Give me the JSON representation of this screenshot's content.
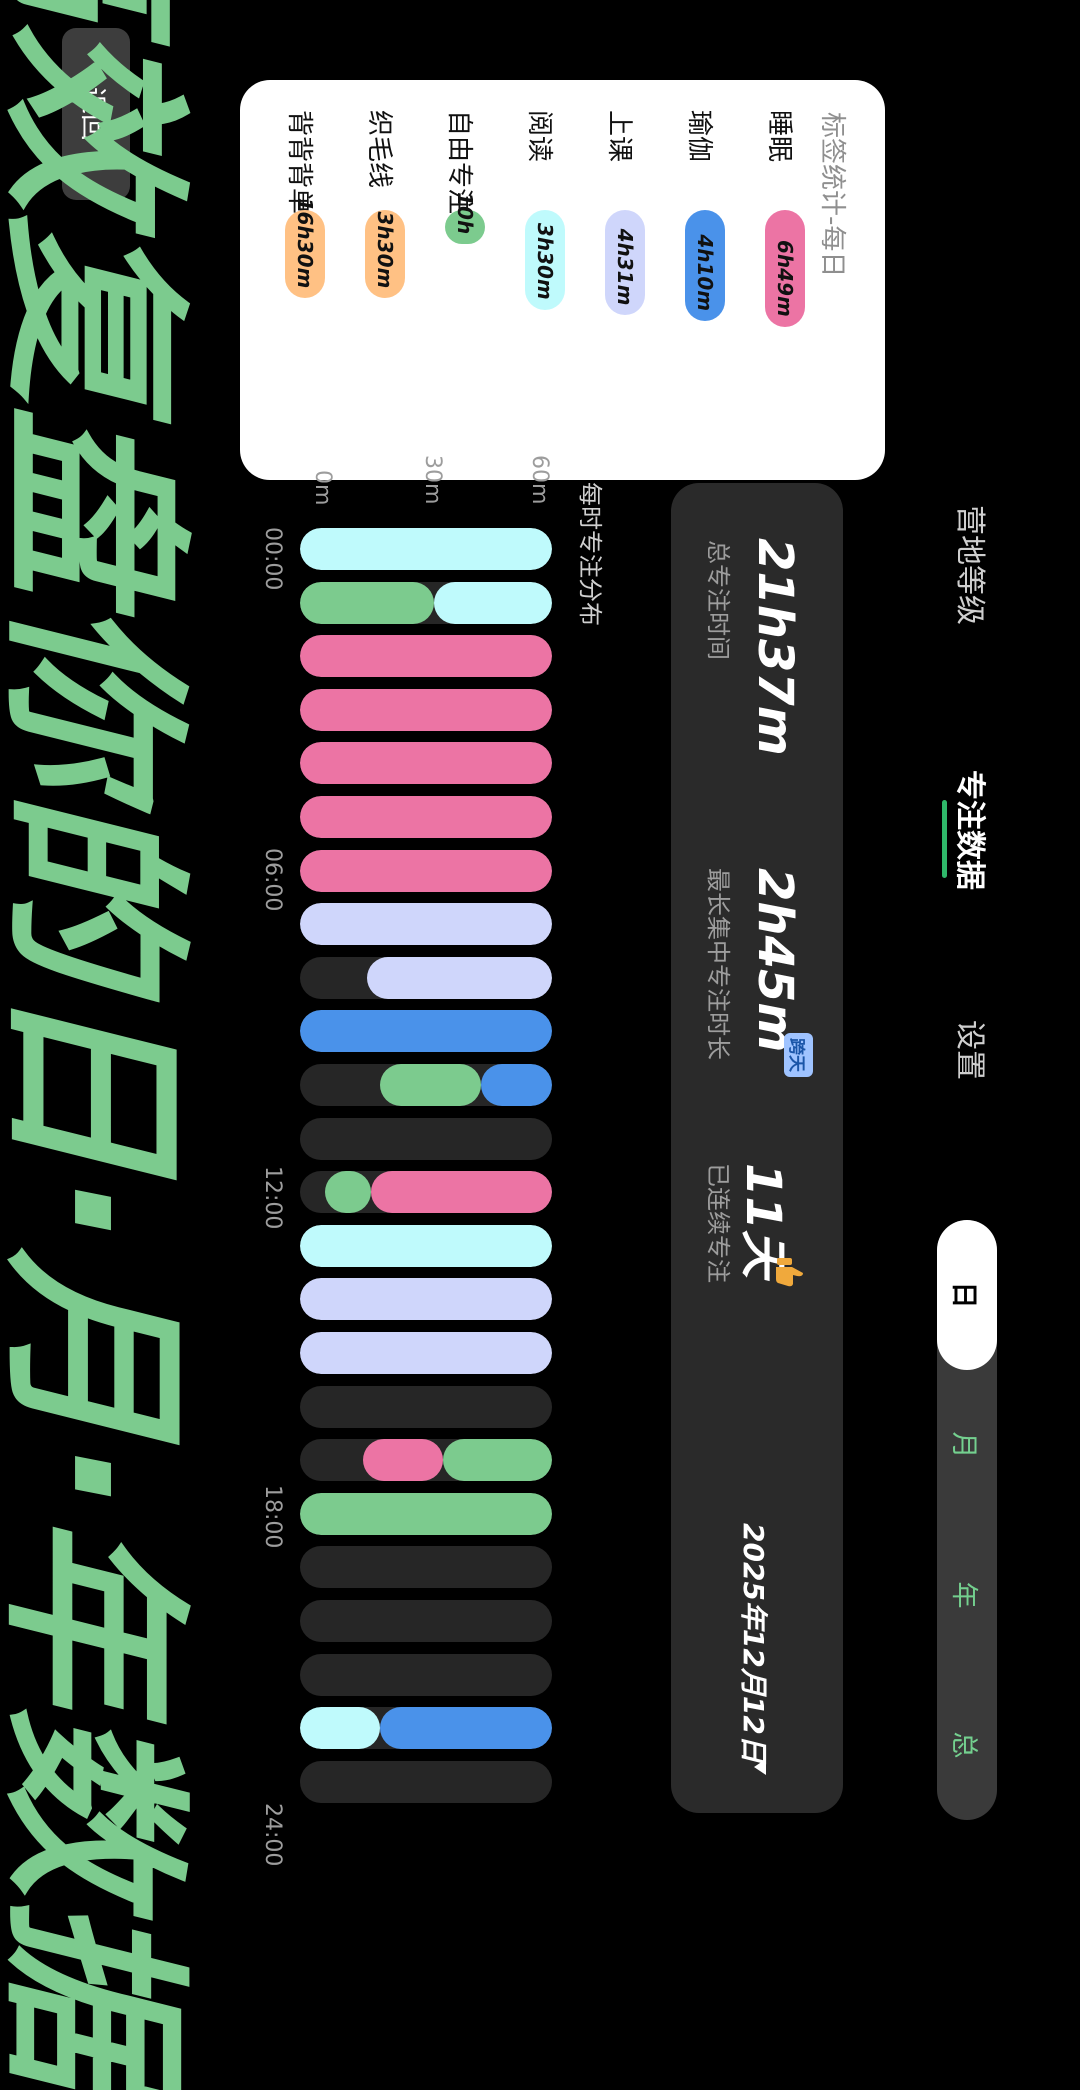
{
  "header": {
    "back_label": "返回",
    "nav_tabs": [
      {
        "label": "营地等级",
        "active": false
      },
      {
        "label": "专注数据",
        "active": true
      },
      {
        "label": "设置",
        "active": false
      }
    ],
    "period_tabs": [
      {
        "label": "日",
        "active": true
      },
      {
        "label": "月",
        "active": false
      },
      {
        "label": "年",
        "active": false
      },
      {
        "label": "总",
        "active": false
      }
    ]
  },
  "tag_stats": {
    "title": "标签统计-每日",
    "items": [
      {
        "name": "睡眠",
        "value": "6h49m",
        "color": "#ec74a4",
        "fraction": 0.41
      },
      {
        "name": "瑜伽",
        "value": "4h10m",
        "color": "#4a92ea",
        "fraction": 0.39
      },
      {
        "name": "上课",
        "value": "4h31m",
        "color": "#cfd6fb",
        "fraction": 0.37
      },
      {
        "name": "阅读",
        "value": "3h30m",
        "color": "#bffafc",
        "fraction": 0.35
      },
      {
        "name": "自由专注",
        "value": "10h",
        "color": "#7ccb8e",
        "fraction": 0.12
      },
      {
        "name": "织毛线",
        "value": "3h30m",
        "color": "#ffc184",
        "fraction": 0.31
      },
      {
        "name": "背背背单词",
        "value": "16h30m",
        "color": "#ffc184",
        "fraction": 0.31
      }
    ]
  },
  "summary": {
    "total_value": "21h37m",
    "total_label": "总专注时间",
    "longest_value": "2h45m",
    "longest_badge": "跨天",
    "longest_label": "最长集中专注时长",
    "streak_value": "11天",
    "streak_label": "已连续专注",
    "streak_icon": "thumbs-up-icon",
    "date": "2025年12月12日",
    "date_icon": "caret-down-icon"
  },
  "hourly_chart": {
    "title": "每时专注分布",
    "y_ticks": [
      "60m",
      "30m",
      "0m"
    ],
    "x_ticks": [
      "00:00",
      "06:00",
      "12:00",
      "18:00",
      "24:00"
    ]
  },
  "chart_data": {
    "type": "bar",
    "title": "每时专注分布",
    "categories": [
      "00",
      "01",
      "02",
      "03",
      "04",
      "05",
      "06",
      "07",
      "08",
      "09",
      "10",
      "11",
      "12",
      "13",
      "14",
      "15",
      "16",
      "17",
      "18",
      "19",
      "20",
      "21",
      "22",
      "23"
    ],
    "ylim": [
      0,
      60
    ],
    "y_unit": "m",
    "colors": {
      "睡眠": "#ec74a4",
      "瑜伽": "#4a92ea",
      "上课": "#cfd6fb",
      "阅读": "#bffafc",
      "自由专注": "#7ccb8e"
    },
    "stacks": [
      [
        {
          "tag": "阅读",
          "minutes": 60
        }
      ],
      [
        {
          "tag": "阅读",
          "minutes": 28
        },
        {
          "tag": "自由专注",
          "minutes": 32
        }
      ],
      [
        {
          "tag": "睡眠",
          "minutes": 60
        }
      ],
      [
        {
          "tag": "睡眠",
          "minutes": 60
        }
      ],
      [
        {
          "tag": "睡眠",
          "minutes": 60
        }
      ],
      [
        {
          "tag": "睡眠",
          "minutes": 60
        }
      ],
      [
        {
          "tag": "睡眠",
          "minutes": 60
        }
      ],
      [
        {
          "tag": "上课",
          "minutes": 60
        }
      ],
      [
        {
          "tag": "上课",
          "minutes": 44
        }
      ],
      [
        {
          "tag": "瑜伽",
          "minutes": 60
        }
      ],
      [
        {
          "tag": "瑜伽",
          "minutes": 17
        },
        {
          "tag": "自由专注",
          "minutes": 24
        }
      ],
      [],
      [
        {
          "tag": "睡眠",
          "minutes": 43
        },
        {
          "tag": "自由专注",
          "minutes": 11
        }
      ],
      [
        {
          "tag": "阅读",
          "minutes": 60
        }
      ],
      [
        {
          "tag": "上课",
          "minutes": 60
        }
      ],
      [
        {
          "tag": "上课",
          "minutes": 60
        }
      ],
      [],
      [
        {
          "tag": "自由专注",
          "minutes": 26
        },
        {
          "tag": "睡眠",
          "minutes": 19
        }
      ],
      [
        {
          "tag": "自由专注",
          "minutes": 60
        }
      ],
      [],
      [],
      [],
      [
        {
          "tag": "瑜伽",
          "minutes": 41
        },
        {
          "tag": "阅读",
          "minutes": 19
        }
      ]
    ]
  },
  "headline": "高效复盘你的日·月·年数据"
}
